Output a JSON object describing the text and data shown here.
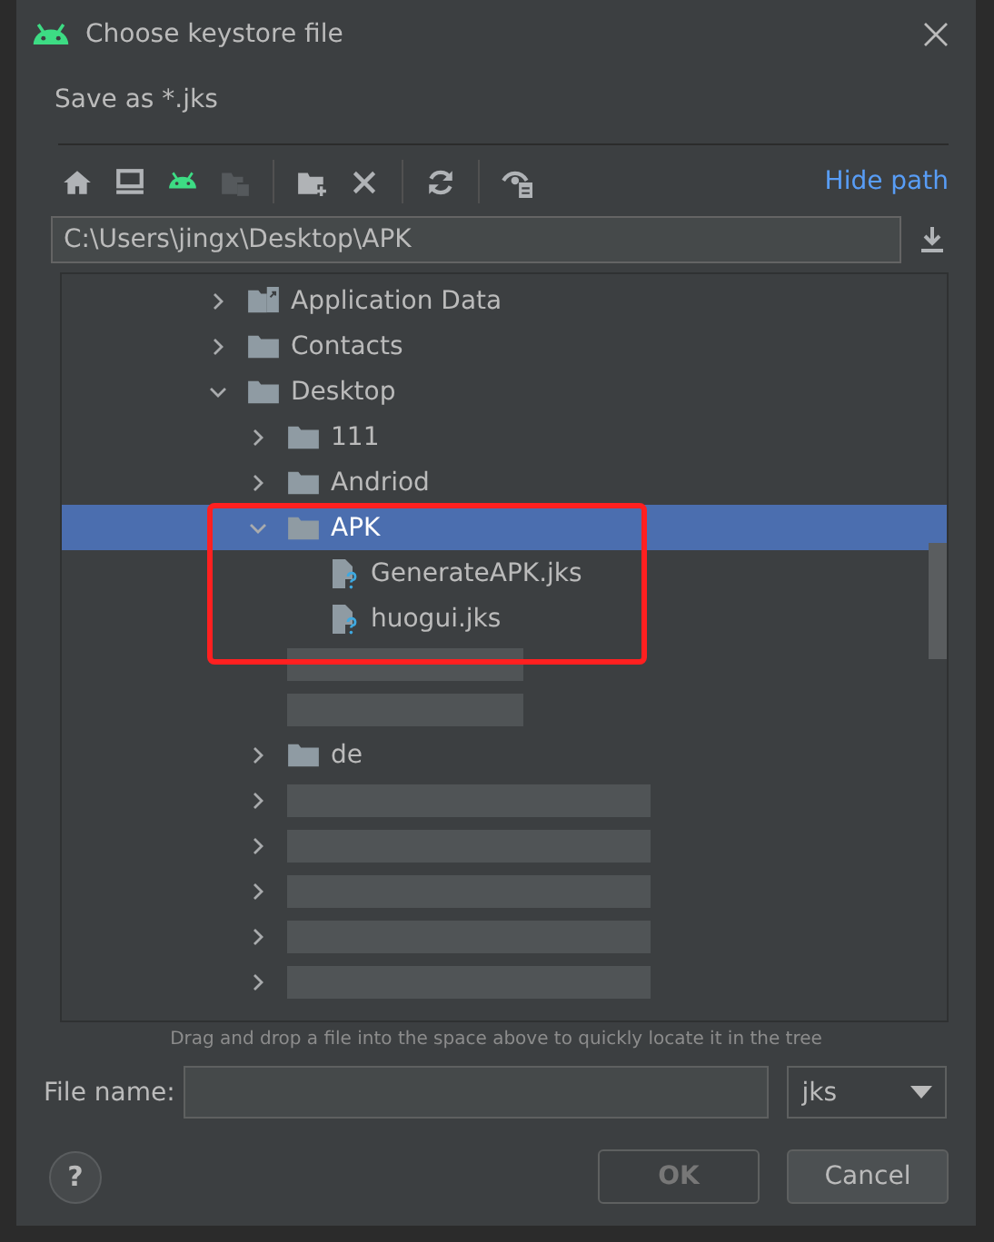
{
  "window": {
    "title": "Choose keystore file"
  },
  "description": "Save as *.jks",
  "toolbar": {
    "hide_path_link": "Hide path"
  },
  "path_field": {
    "value": "C:\\Users\\jingx\\Desktop\\APK"
  },
  "tree": [
    {
      "kind": "shortcut-folder",
      "label": "Application Data",
      "expanded": false,
      "selected": false
    },
    {
      "kind": "folder",
      "label": "Contacts",
      "expanded": false,
      "selected": false
    },
    {
      "kind": "folder",
      "label": "Desktop",
      "expanded": true,
      "selected": false,
      "children": [
        {
          "kind": "folder",
          "label": "111",
          "expanded": false,
          "selected": false
        },
        {
          "kind": "folder",
          "label": "Andriod",
          "expanded": false,
          "selected": false
        },
        {
          "kind": "folder",
          "label": "APK",
          "expanded": true,
          "selected": true,
          "children": [
            {
              "kind": "file",
              "label": "GenerateAPK.jks",
              "selected": false
            },
            {
              "kind": "file",
              "label": "huogui.jks",
              "selected": false
            }
          ]
        },
        {
          "kind": "redacted",
          "selected": false
        },
        {
          "kind": "redacted",
          "selected": false
        },
        {
          "kind": "folder",
          "label": "de",
          "expanded": false,
          "selected": false
        },
        {
          "kind": "redacted-folder",
          "expanded": false,
          "selected": false
        },
        {
          "kind": "redacted-folder",
          "expanded": false,
          "selected": false
        },
        {
          "kind": "redacted-folder",
          "expanded": false,
          "selected": false
        },
        {
          "kind": "redacted-folder",
          "expanded": false,
          "selected": false
        },
        {
          "kind": "redacted-folder",
          "expanded": false,
          "selected": false
        }
      ]
    }
  ],
  "hint": "Drag and drop a file into the space above to quickly locate it in the tree",
  "file_name": {
    "label": "File name:"
  },
  "file_type": {
    "value": "jks"
  },
  "buttons": [
    {
      "kind": "help",
      "label": "?"
    },
    {
      "kind": "ok",
      "label": "OK",
      "disabled": true
    },
    {
      "kind": "cancel",
      "label": "Cancel",
      "disabled": false
    }
  ]
}
